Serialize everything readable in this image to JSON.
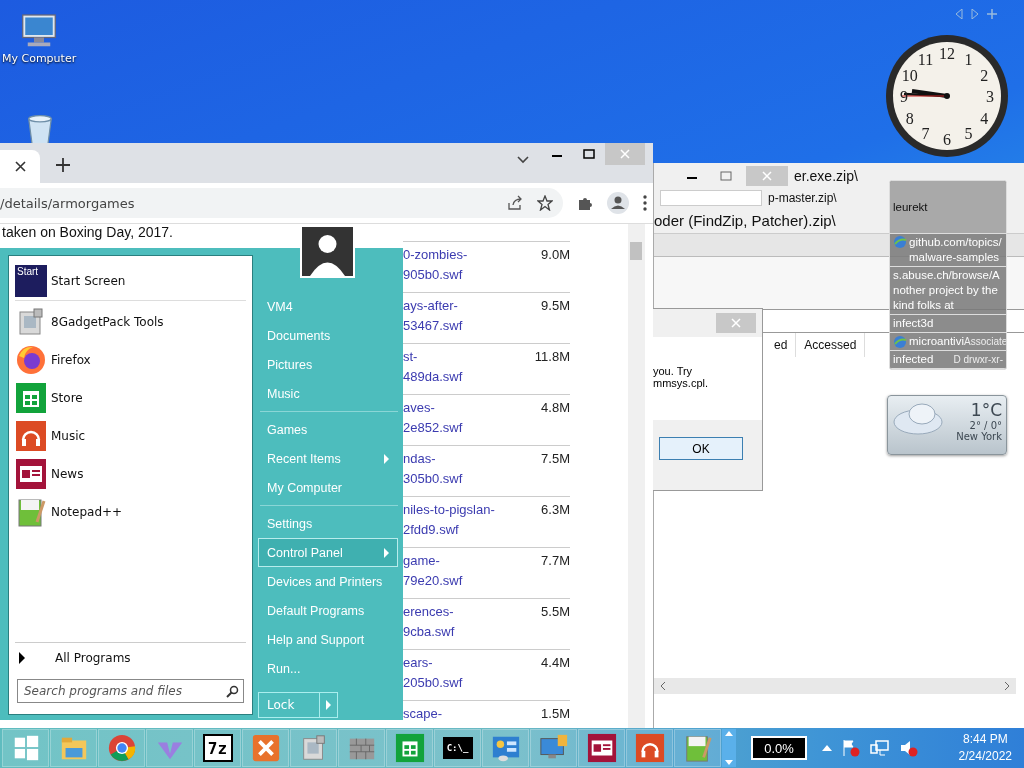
{
  "desktop_icons": [
    {
      "kind": "computer",
      "label": "My Computer"
    },
    {
      "kind": "recycle"
    }
  ],
  "clock": {
    "numerals": [
      "12",
      "11",
      "1",
      "10",
      "2",
      "9",
      "3",
      "8",
      "4",
      "7",
      "5",
      "6"
    ]
  },
  "weather": {
    "temperature": "1°C",
    "range": "2° / 0°",
    "city": "New York"
  },
  "browser": {
    "address": "/details/armorgames",
    "caption": "taken on Boxing Day, 2017.",
    "files": [
      {
        "name": [
          "0-zombies-",
          "905b0.swf"
        ],
        "size": "9.0M"
      },
      {
        "name": [
          "ays-after-",
          "53467.swf"
        ],
        "size": "9.5M"
      },
      {
        "name": [
          "st-",
          "489da.swf"
        ],
        "size": "11.8M"
      },
      {
        "name": [
          "aves-",
          "2e852.swf"
        ],
        "size": "4.8M"
      },
      {
        "name": [
          "ndas-",
          "305b0.swf"
        ],
        "size": "7.5M"
      },
      {
        "name": [
          "niles-to-pigslan-",
          "2fdd9.swf"
        ],
        "size": "6.3M"
      },
      {
        "name": [
          "game-",
          "79e20.swf"
        ],
        "size": "7.7M"
      },
      {
        "name": [
          "erences-",
          "9cba.swf"
        ],
        "size": "5.5M"
      },
      {
        "name": [
          "ears-",
          "205b0.swf"
        ],
        "size": "4.4M"
      },
      {
        "name": [
          "scape-"
        ],
        "size": "1.5M"
      }
    ]
  },
  "archive": {
    "titles": [
      "er.exe.zip\\",
      "p-master.zip\\",
      "oder (FindZip, Patcher).zip\\"
    ],
    "columns": [
      "ed",
      "Accessed"
    ],
    "dialog": {
      "lines": [
        "you. Try",
        "mmsys.cpl."
      ],
      "button": "OK"
    }
  },
  "popup": {
    "items": [
      {
        "kind": "title",
        "text": "leurekt"
      },
      {
        "kind": "link",
        "text": "github.com/topics/malware-samples"
      },
      {
        "kind": "text",
        "text": "s.abuse.ch/browse/Another project by the kind folks at"
      },
      {
        "kind": "text",
        "text": "infect3d"
      },
      {
        "kind": "link",
        "text": "microantivi",
        "overlay": "Associate"
      },
      {
        "kind": "text",
        "text": "infected",
        "overlay": "D drwxr-xr-"
      }
    ]
  },
  "start_menu": {
    "programs": [
      {
        "kind": "start",
        "label": "Start Screen",
        "tile": "Start"
      },
      {
        "kind": "gadget",
        "label": "8GadgetPack Tools"
      },
      {
        "kind": "firefox",
        "label": "Firefox"
      },
      {
        "kind": "store",
        "label": "Store"
      },
      {
        "kind": "music",
        "label": "Music"
      },
      {
        "kind": "news",
        "label": "News"
      },
      {
        "kind": "notepad",
        "label": "Notepad++"
      }
    ],
    "all_programs": "All Programs",
    "search": {
      "placeholder": "Search programs and files"
    },
    "places": [
      {
        "label": "VM4",
        "submenu": false,
        "selected": false
      },
      {
        "label": "Documents",
        "submenu": false,
        "selected": false
      },
      {
        "label": "Pictures",
        "submenu": false,
        "selected": false
      },
      {
        "label": "Music",
        "submenu": false,
        "selected": false
      },
      {
        "kind": "divider"
      },
      {
        "label": "Games",
        "submenu": false,
        "selected": false
      },
      {
        "label": "Recent Items",
        "submenu": true,
        "selected": false
      },
      {
        "label": "My Computer",
        "submenu": false,
        "selected": false
      },
      {
        "kind": "divider"
      },
      {
        "label": "Settings",
        "submenu": false,
        "selected": false
      },
      {
        "label": "Control Panel",
        "submenu": true,
        "selected": true
      },
      {
        "label": "Devices and Printers",
        "submenu": false,
        "selected": false
      },
      {
        "label": "Default Programs",
        "submenu": false,
        "selected": false
      },
      {
        "label": "Help and Support",
        "submenu": false,
        "selected": false
      },
      {
        "label": "Run...",
        "submenu": false,
        "selected": false
      }
    ],
    "power_button": "Lock"
  },
  "taskbar": {
    "apps": [
      {
        "kind": "windows"
      },
      {
        "kind": "explorer"
      },
      {
        "kind": "chrome"
      },
      {
        "kind": "vlogo"
      },
      {
        "kind": "sevenzip",
        "label": "7z"
      },
      {
        "kind": "xampp"
      },
      {
        "kind": "gadget"
      },
      {
        "kind": "firewall"
      },
      {
        "kind": "store"
      },
      {
        "kind": "cmd",
        "label": "C:\\_"
      },
      {
        "kind": "control"
      },
      {
        "kind": "monitor"
      },
      {
        "kind": "news"
      },
      {
        "kind": "music"
      },
      {
        "kind": "notepad"
      }
    ],
    "battery": "0.0%",
    "time": "8:44 PM",
    "date": "2/24/2022"
  }
}
